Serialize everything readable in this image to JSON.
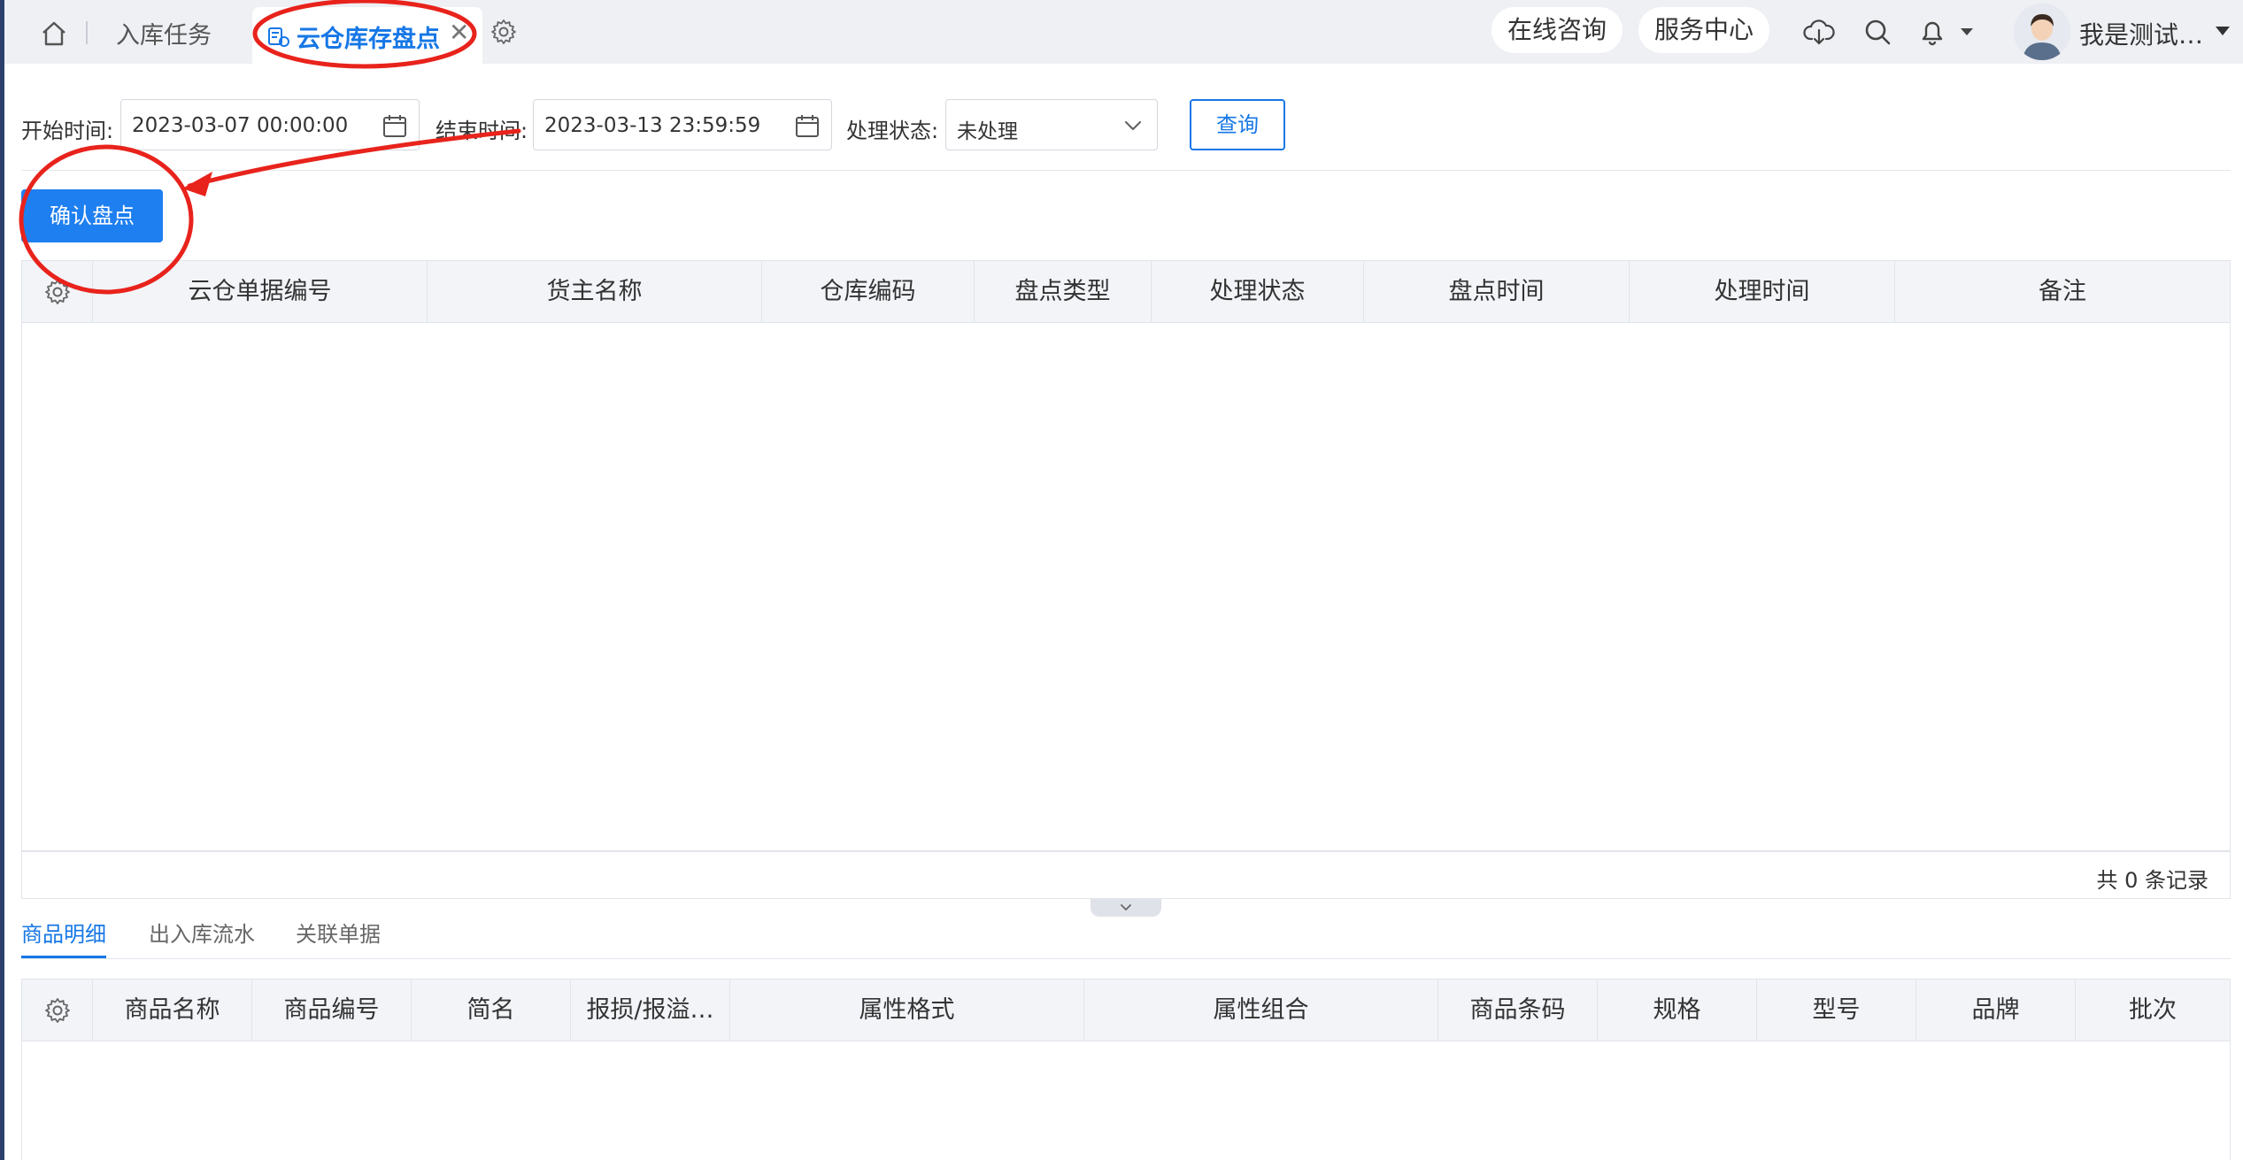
{
  "topbar": {
    "tabs": [
      {
        "label": "入库任务"
      },
      {
        "label": "云仓库存盘点",
        "close": "✕"
      }
    ],
    "online_consult": "在线咨询",
    "service_center": "服务中心",
    "username": "我是测试…"
  },
  "filters": {
    "start_label": "开始时间:",
    "start_value": "2023-03-07 00:00:00",
    "end_label": "结束时间:",
    "end_value": "2023-03-13 23:59:59",
    "status_label": "处理状态:",
    "status_value": "未处理",
    "query_label": "查询"
  },
  "actions": {
    "confirm_label": "确认盘点"
  },
  "main_table": {
    "columns": [
      "云仓单据编号",
      "货主名称",
      "仓库编码",
      "盘点类型",
      "处理状态",
      "盘点时间",
      "处理时间",
      "备注"
    ],
    "rows": [],
    "record_count": "共 0 条记录"
  },
  "bottom_tabs": [
    "商品明细",
    "出入库流水",
    "关联单据"
  ],
  "detail_table": {
    "columns": [
      "商品名称",
      "商品编号",
      "简名",
      "报损/报溢…",
      "属性格式",
      "属性组合",
      "商品条码",
      "规格",
      "型号",
      "品牌",
      "批次"
    ],
    "rows": []
  },
  "colors": {
    "accent": "#1677e6",
    "primary_button": "#1e7ff0",
    "annotation": "#e8231c",
    "topbar_bg": "#eef0f4",
    "table_header_bg": "#f2f4f8"
  },
  "icons": [
    "home-icon",
    "tab-icon",
    "close-icon",
    "gear-icon",
    "cloud-download-icon",
    "search-icon",
    "bell-icon",
    "calendar-icon",
    "chevron-down-icon"
  ]
}
